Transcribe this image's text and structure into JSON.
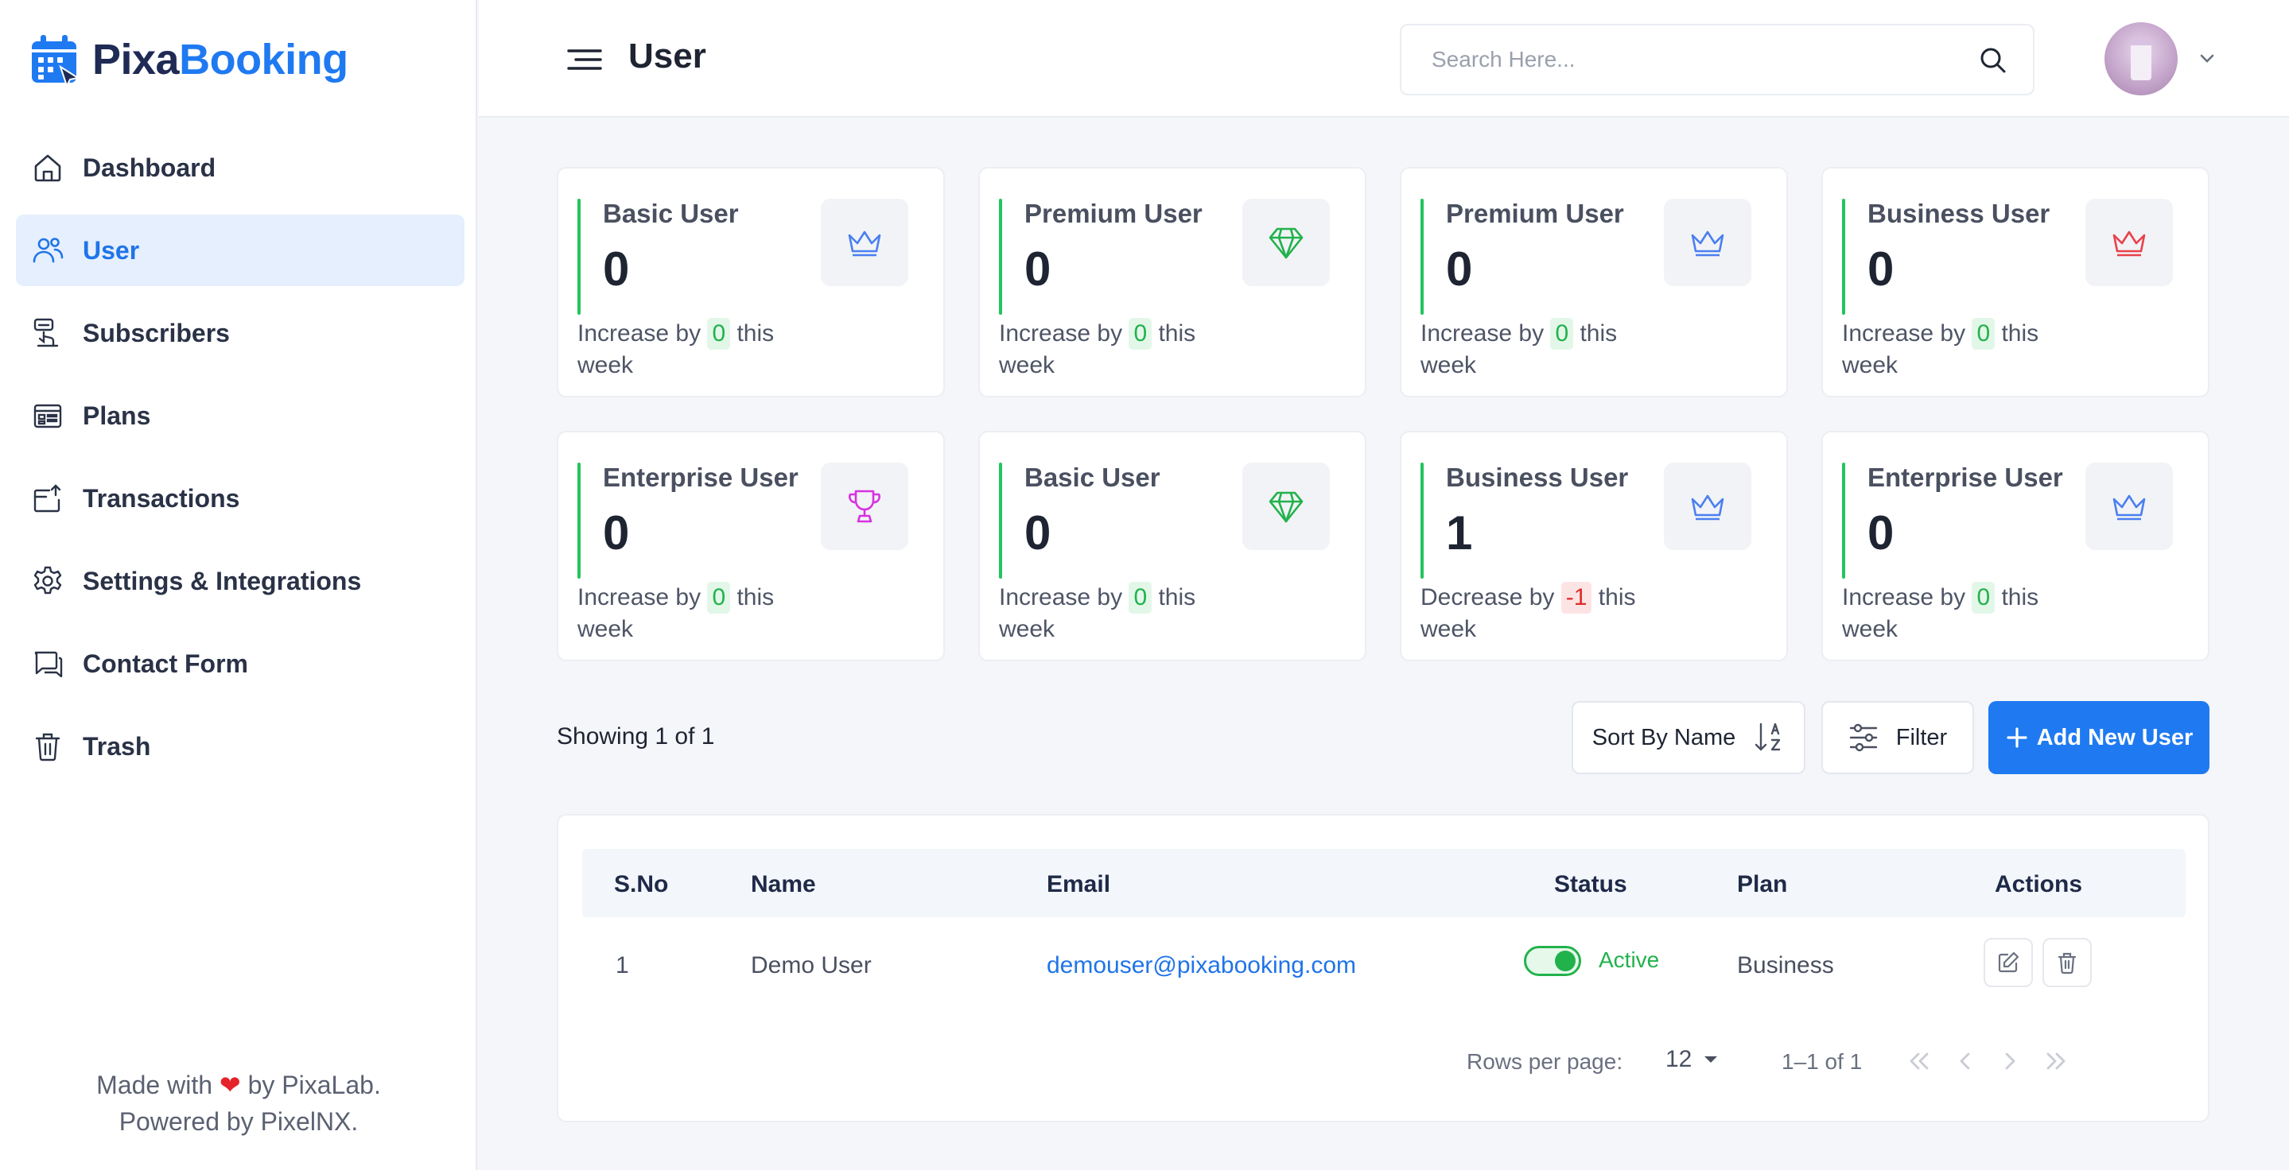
{
  "brand": {
    "name_part1": "Pixa",
    "name_part2": "Booking"
  },
  "sidebar": {
    "items": [
      {
        "label": "Dashboard",
        "icon": "home-icon",
        "active": false
      },
      {
        "label": "User",
        "icon": "users-icon",
        "active": true
      },
      {
        "label": "Subscribers",
        "icon": "subscribers-icon",
        "active": false
      },
      {
        "label": "Plans",
        "icon": "plans-icon",
        "active": false
      },
      {
        "label": "Transactions",
        "icon": "transactions-icon",
        "active": false
      },
      {
        "label": "Settings & Integrations",
        "icon": "gear-icon",
        "active": false
      },
      {
        "label": "Contact Form",
        "icon": "chat-icon",
        "active": false
      },
      {
        "label": "Trash",
        "icon": "trash-icon",
        "active": false
      }
    ],
    "footer_line1_pre": "Made with ",
    "footer_line1_post": " by PixaLab.",
    "footer_line2": "Powered by PixelNX."
  },
  "header": {
    "title": "User",
    "search_placeholder": "Search Here..."
  },
  "stats": [
    {
      "label": "Basic User",
      "value": "0",
      "trend_pre": "Increase by",
      "trend_value": "0",
      "trend_dir": "up",
      "trend_post": "this week",
      "icon": "crown-icon",
      "icon_color": "#4a7ff0"
    },
    {
      "label": "Premium User",
      "value": "0",
      "trend_pre": "Increase by",
      "trend_value": "0",
      "trend_dir": "up",
      "trend_post": "this week",
      "icon": "diamond-icon",
      "icon_color": "#22b24c"
    },
    {
      "label": "Premium User",
      "value": "0",
      "trend_pre": "Increase by",
      "trend_value": "0",
      "trend_dir": "up",
      "trend_post": "this week",
      "icon": "crown-icon",
      "icon_color": "#4a7ff0"
    },
    {
      "label": "Business User",
      "value": "0",
      "trend_pre": "Increase by",
      "trend_value": "0",
      "trend_dir": "up",
      "trend_post": "this week",
      "icon": "crown-icon",
      "icon_color": "#e8414a"
    },
    {
      "label": "Enterprise User",
      "value": "0",
      "trend_pre": "Increase by",
      "trend_value": "0",
      "trend_dir": "up",
      "trend_post": "this week",
      "icon": "trophy-icon",
      "icon_color": "#d633e0"
    },
    {
      "label": "Basic User",
      "value": "0",
      "trend_pre": "Increase by",
      "trend_value": "0",
      "trend_dir": "up",
      "trend_post": "this week",
      "icon": "diamond-icon",
      "icon_color": "#22b24c"
    },
    {
      "label": "Business User",
      "value": "1",
      "trend_pre": "Decrease by",
      "trend_value": "-1",
      "trend_dir": "down",
      "trend_post": "this week",
      "icon": "crown-icon",
      "icon_color": "#4a7ff0"
    },
    {
      "label": "Enterprise User",
      "value": "0",
      "trend_pre": "Increase by",
      "trend_value": "0",
      "trend_dir": "up",
      "trend_post": "this week",
      "icon": "crown-icon",
      "icon_color": "#4a7ff0"
    }
  ],
  "toolbar": {
    "showing": "Showing 1 of 1",
    "sort_label": "Sort By Name",
    "filter_label": "Filter",
    "add_label": "Add New User"
  },
  "table": {
    "columns": [
      "S.No",
      "Name",
      "Email",
      "Status",
      "Plan",
      "Actions"
    ],
    "rows": [
      {
        "sno": "1",
        "name": "Demo User",
        "email": "demouser@pixabooking.com",
        "status": "Active",
        "status_on": true,
        "plan": "Business"
      }
    ],
    "rows_per_page_label": "Rows per page:",
    "rows_per_page_value": "12",
    "range": "1–1 of 1"
  },
  "colors": {
    "accent": "#1f7af2",
    "success": "#22b24c",
    "danger": "#e02b2b"
  }
}
